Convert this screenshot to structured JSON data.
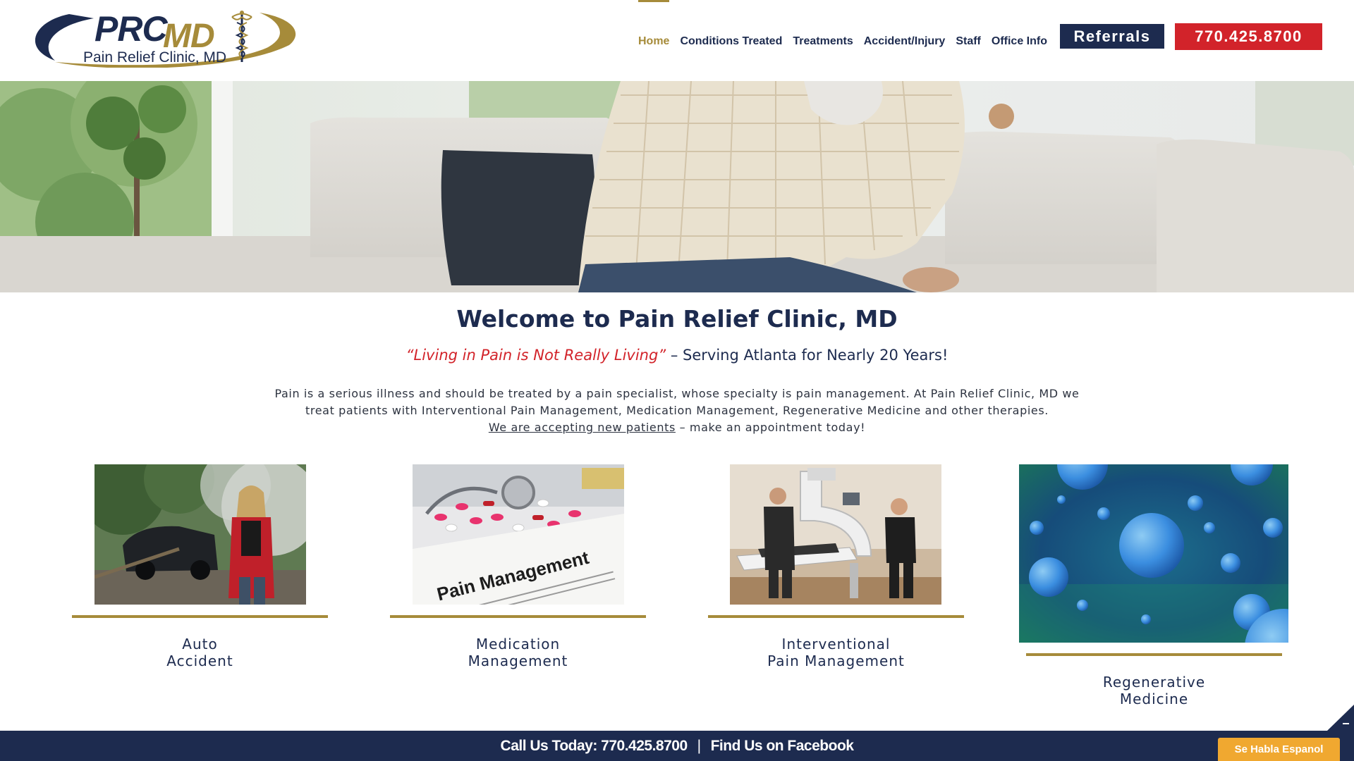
{
  "logo": {
    "prc": "PRC",
    "md": "MD",
    "subtitle": "Pain Relief Clinic, MD"
  },
  "nav": {
    "items": [
      {
        "label": "Home",
        "active": true
      },
      {
        "label": "Conditions Treated"
      },
      {
        "label": "Treatments"
      },
      {
        "label": "Accident/Injury"
      },
      {
        "label": "Staff"
      },
      {
        "label": "Office Info"
      }
    ],
    "referrals_label": "Referrals",
    "phone_label": "770.425.8700"
  },
  "welcome": {
    "title": "Welcome to Pain Relief Clinic, MD",
    "quote": "“Living in Pain is Not Really Living”",
    "tagline_rest": " – Serving Atlanta for Nearly 20 Years!",
    "intro_line1": "Pain is a serious illness and should be treated by a pain specialist, whose specialty is pain management. At Pain Relief Clinic, MD we",
    "intro_line2": "treat patients with Interventional Pain Management, Medication Management, Regenerative Medicine and other therapies.",
    "accepting_link": "We are accepting new patients",
    "accepting_rest": " – make an appointment today!"
  },
  "cards": [
    {
      "line1": "Auto",
      "line2": "Accident"
    },
    {
      "line1": "Medication",
      "line2": "Management",
      "image_text": "Pain Management"
    },
    {
      "line1": "Interventional",
      "line2": "Pain Management"
    },
    {
      "line1": "Regenerative",
      "line2": "Medicine"
    }
  ],
  "footer": {
    "call": "Call Us Today: 770.425.8700",
    "sep": "|",
    "facebook": "Find Us on Facebook"
  },
  "se_habla": "Se Habla Espanol",
  "colors": {
    "navy": "#1d2b4f",
    "gold": "#a68b3a",
    "red": "#d2232a",
    "orange": "#f0a830"
  }
}
